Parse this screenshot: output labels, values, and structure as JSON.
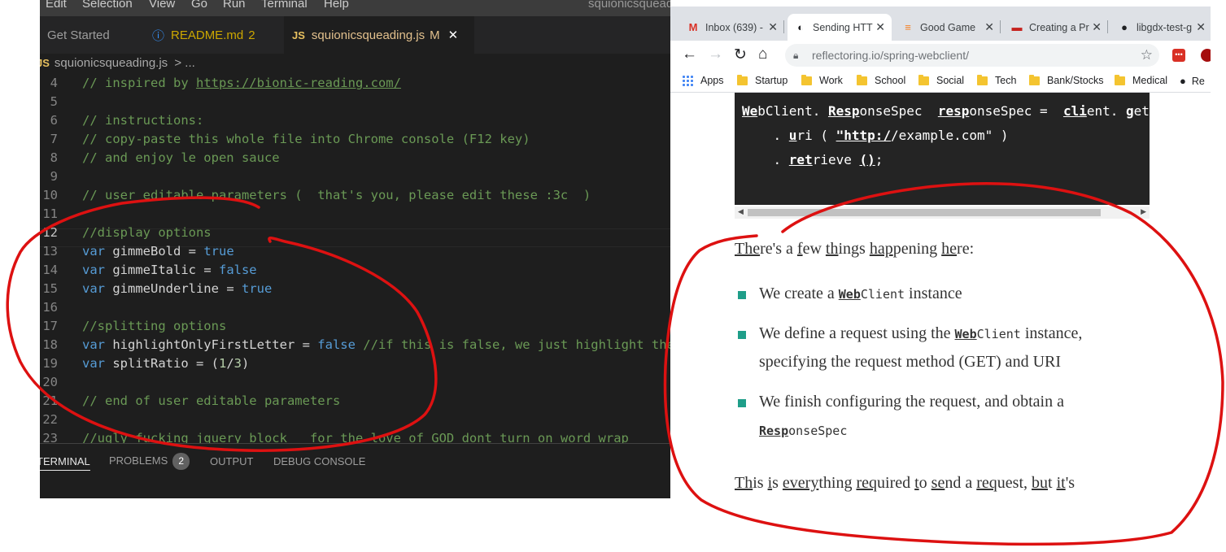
{
  "vscode": {
    "menu": [
      "Edit",
      "Selection",
      "View",
      "Go",
      "Run",
      "Terminal",
      "Help"
    ],
    "window_title": "squionicsqueading.js - squionicsqueading - Visual Studio Code",
    "tabs": [
      {
        "icon": "",
        "label": "Get Started",
        "badge": ""
      },
      {
        "icon": "ⓘ",
        "label": "README.md",
        "badge": "2"
      },
      {
        "icon": "JS",
        "label": "squionicsqueading.js",
        "badge": "M",
        "close": "✕"
      }
    ],
    "breadcrumb": {
      "icon": "JS",
      "file": "squionicsqueading.js",
      "sep": ">",
      "more": "..."
    },
    "lines": [
      {
        "n": "4",
        "parts": [
          {
            "t": "// inspired by ",
            "c": "com"
          },
          {
            "t": "https://bionic-reading.com/",
            "c": "link"
          }
        ]
      },
      {
        "n": "5",
        "parts": []
      },
      {
        "n": "6",
        "parts": [
          {
            "t": "// instructions:",
            "c": "com"
          }
        ]
      },
      {
        "n": "7",
        "parts": [
          {
            "t": "// copy-paste this whole file into Chrome console (F12 key)",
            "c": "com"
          }
        ]
      },
      {
        "n": "8",
        "parts": [
          {
            "t": "// and enjoy le open sauce",
            "c": "com"
          }
        ]
      },
      {
        "n": "9",
        "parts": []
      },
      {
        "n": "10",
        "parts": [
          {
            "t": "// user editable parameters (  that's you, please edit these :3c  )",
            "c": "com"
          }
        ]
      },
      {
        "n": "11",
        "parts": []
      },
      {
        "n": "12",
        "parts": [
          {
            "t": "//display options",
            "c": "com"
          }
        ]
      },
      {
        "n": "13",
        "parts": [
          {
            "t": "var ",
            "c": "kw"
          },
          {
            "t": "gimmeBold",
            "c": "var"
          },
          {
            "t": " = ",
            "c": "var"
          },
          {
            "t": "true",
            "c": "kw"
          }
        ]
      },
      {
        "n": "14",
        "parts": [
          {
            "t": "var ",
            "c": "kw"
          },
          {
            "t": "gimmeItalic",
            "c": "var"
          },
          {
            "t": " = ",
            "c": "var"
          },
          {
            "t": "false",
            "c": "kw"
          }
        ]
      },
      {
        "n": "15",
        "parts": [
          {
            "t": "var ",
            "c": "kw"
          },
          {
            "t": "gimmeUnderline",
            "c": "var"
          },
          {
            "t": " = ",
            "c": "var"
          },
          {
            "t": "true",
            "c": "kw"
          }
        ]
      },
      {
        "n": "16",
        "parts": []
      },
      {
        "n": "17",
        "parts": [
          {
            "t": "//splitting options",
            "c": "com"
          }
        ]
      },
      {
        "n": "18",
        "parts": [
          {
            "t": "var ",
            "c": "kw"
          },
          {
            "t": "highlightOnlyFirstLetter",
            "c": "var"
          },
          {
            "t": " = ",
            "c": "var"
          },
          {
            "t": "false",
            "c": "kw"
          },
          {
            "t": " //if this is false, we just highlight the",
            "c": "com"
          }
        ]
      },
      {
        "n": "19",
        "parts": [
          {
            "t": "var ",
            "c": "kw"
          },
          {
            "t": "splitRatio",
            "c": "var"
          },
          {
            "t": " = (",
            "c": "var"
          },
          {
            "t": "1",
            "c": "num"
          },
          {
            "t": "/",
            "c": "var"
          },
          {
            "t": "3",
            "c": "num"
          },
          {
            "t": ")",
            "c": "var"
          }
        ]
      },
      {
        "n": "20",
        "parts": []
      },
      {
        "n": "21",
        "parts": [
          {
            "t": "// end of user editable parameters",
            "c": "com"
          }
        ]
      },
      {
        "n": "22",
        "parts": []
      },
      {
        "n": "23",
        "parts": [
          {
            "t": "//ugly fucking jquery block   for the love of GOD dont turn on word wrap",
            "c": "com"
          }
        ]
      }
    ],
    "current_line": "12",
    "panel_tabs": [
      {
        "label": "TERMINAL",
        "badge": ""
      },
      {
        "label": "PROBLEMS",
        "badge": "2"
      },
      {
        "label": "OUTPUT",
        "badge": ""
      },
      {
        "label": "DEBUG CONSOLE",
        "badge": ""
      }
    ]
  },
  "chrome": {
    "tabs": [
      {
        "favicon": "M",
        "label": "Inbox (639) -",
        "color": "#d93025"
      },
      {
        "favicon": "◐",
        "label": "Sending HTT",
        "color": "#202124"
      },
      {
        "favicon": "≡",
        "label": "Good Game",
        "color": "#f48024"
      },
      {
        "favicon": "▬",
        "label": "Creating a Pr",
        "color": "#c5221f"
      },
      {
        "favicon": "●",
        "label": "libgdx-test-g",
        "color": "#202124"
      }
    ],
    "tab_close": "✕",
    "url_host": "reflectoring.io",
    "url_path": "/spring-webclient/",
    "bookmarks": [
      "Apps",
      "Startup",
      "Work",
      "School",
      "Social",
      "Tech",
      "Bank/Stocks",
      "Medical",
      "Re"
    ],
    "code_lines": [
      [
        {
          "b": "We"
        },
        {
          "t": "bClient. "
        },
        {
          "b": "Resp"
        },
        {
          "t": "onseSpec  "
        },
        {
          "b": "resp"
        },
        {
          "t": "onseSpec =  "
        },
        {
          "b": "cli"
        },
        {
          "t": "ent. "
        },
        {
          "b": "g"
        },
        {
          "t": "et"
        }
      ],
      [
        {
          "t": "    . "
        },
        {
          "b": "u"
        },
        {
          "t": "ri ( "
        },
        {
          "b": "\"http:/"
        },
        {
          "t": "/example.com\" )"
        }
      ],
      [
        {
          "t": "    . "
        },
        {
          "b": "ret"
        },
        {
          "t": "rieve "
        },
        {
          "b": "()"
        },
        {
          "t": ";"
        }
      ]
    ],
    "prose_intro": [
      {
        "u": "The"
      },
      {
        "t": "re's a "
      },
      {
        "u": "f"
      },
      {
        "t": "ew "
      },
      {
        "u": "th"
      },
      {
        "t": "ings "
      },
      {
        "u": "hap"
      },
      {
        "t": "pening "
      },
      {
        "u": "he"
      },
      {
        "t": "re:"
      }
    ],
    "bullets": [
      {
        "lines": [
          [
            {
              "t": "We create a "
            },
            {
              "cb": "Web"
            },
            {
              "c": "Client"
            },
            {
              "t": " instance"
            }
          ]
        ]
      },
      {
        "lines": [
          [
            {
              "t": "We define a request using the "
            },
            {
              "cb": "Web"
            },
            {
              "c": "Client"
            },
            {
              "t": " instance,"
            }
          ],
          [
            {
              "t": "specifying the request method (GET) and URI"
            }
          ]
        ]
      },
      {
        "lines": [
          [
            {
              "t": "We finish configuring the request, and obtain a"
            }
          ],
          [
            {
              "cb": "Resp"
            },
            {
              "c": "onseSpec"
            }
          ]
        ]
      }
    ],
    "prose_outro": [
      {
        "u": "Th"
      },
      {
        "t": "is "
      },
      {
        "u": "i"
      },
      {
        "t": "s "
      },
      {
        "u": "every"
      },
      {
        "t": "thing "
      },
      {
        "u": "req"
      },
      {
        "t": "uired "
      },
      {
        "u": "t"
      },
      {
        "t": "o "
      },
      {
        "u": "se"
      },
      {
        "t": "nd a "
      },
      {
        "u": "req"
      },
      {
        "t": "uest, "
      },
      {
        "u": "bu"
      },
      {
        "t": "t "
      },
      {
        "u": "it"
      },
      {
        "t": "'s"
      }
    ]
  },
  "colors": {
    "annotation_red": "#dd1111",
    "bullet_teal": "#1f9e89",
    "editor_bg": "#1e1e1e",
    "comment_green": "#6a9955",
    "keyword_blue": "#569cd6"
  }
}
